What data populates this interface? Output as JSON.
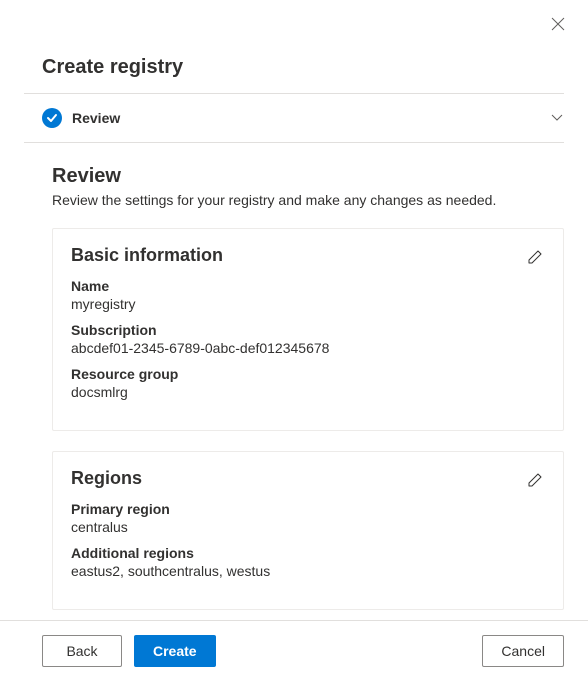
{
  "page_title": "Create registry",
  "step": {
    "label": "Review"
  },
  "review": {
    "title": "Review",
    "subtitle": "Review the settings for your registry and make any changes as needed."
  },
  "basic_info": {
    "card_title": "Basic information",
    "name_label": "Name",
    "name_value": "myregistry",
    "subscription_label": "Subscription",
    "subscription_value": "abcdef01-2345-6789-0abc-def012345678",
    "resource_group_label": "Resource group",
    "resource_group_value": "docsmlrg"
  },
  "regions": {
    "card_title": "Regions",
    "primary_label": "Primary region",
    "primary_value": "centralus",
    "additional_label": "Additional regions",
    "additional_value": "eastus2, southcentralus, westus"
  },
  "footer": {
    "back": "Back",
    "create": "Create",
    "cancel": "Cancel"
  }
}
